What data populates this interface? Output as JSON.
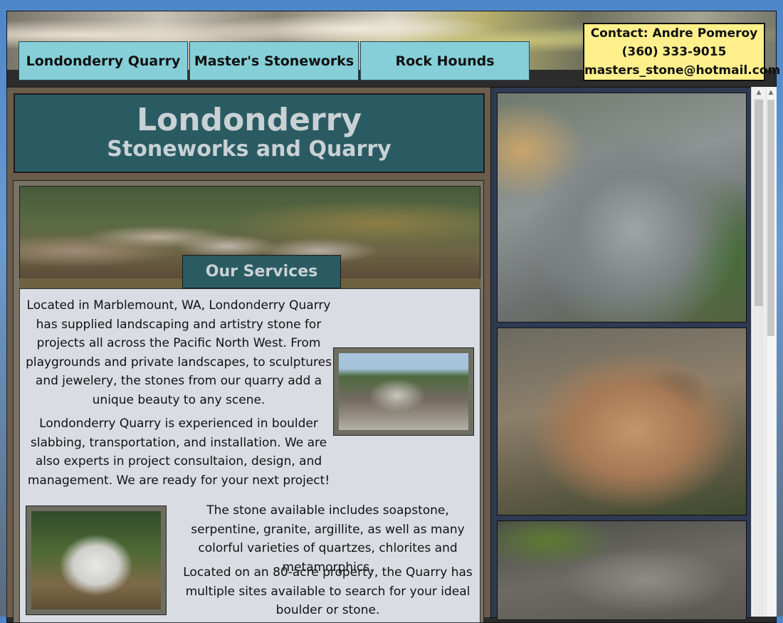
{
  "nav": {
    "tabs": [
      "Londonderry Quarry",
      "Master's Stoneworks",
      "Rock Hounds"
    ]
  },
  "contact": {
    "name": "Contact: Andre Pomeroy",
    "phone": "(360) 333-9015",
    "email": "masters_stone@hotmail.com"
  },
  "header": {
    "title": "Londonderry",
    "subtitle": "Stoneworks and Quarry"
  },
  "services": {
    "tab_label": "Our Services",
    "paragraphs": [
      "Located in Marblemount, WA, Londonderry Quarry has supplied landscaping and artistry stone for projects all across the Pacific North West. From playgrounds and private landscapes, to sculptures and jewelery, the stones from our quarry add a unique beauty to any scene.",
      "Londonderry Quarry is experienced in boulder slabbing, transportation, and installation. We are also experts in project consultaion, design, and management. We are ready for your next project!",
      "The stone available includes soapstone, serpentine, granite, argillite, as well as many colorful varieties of quartzes, chlorites and metamorphics.",
      "Located on an 80-acre property, the Quarry has multiple sites available to search for your ideal boulder or stone."
    ]
  },
  "colors": {
    "nav_tab": "#86cfd8",
    "title_box": "#2a5b63",
    "contact_box": "#fff08c",
    "content_bg": "#d9dde3",
    "gallery_bg": "#2e3a52"
  }
}
